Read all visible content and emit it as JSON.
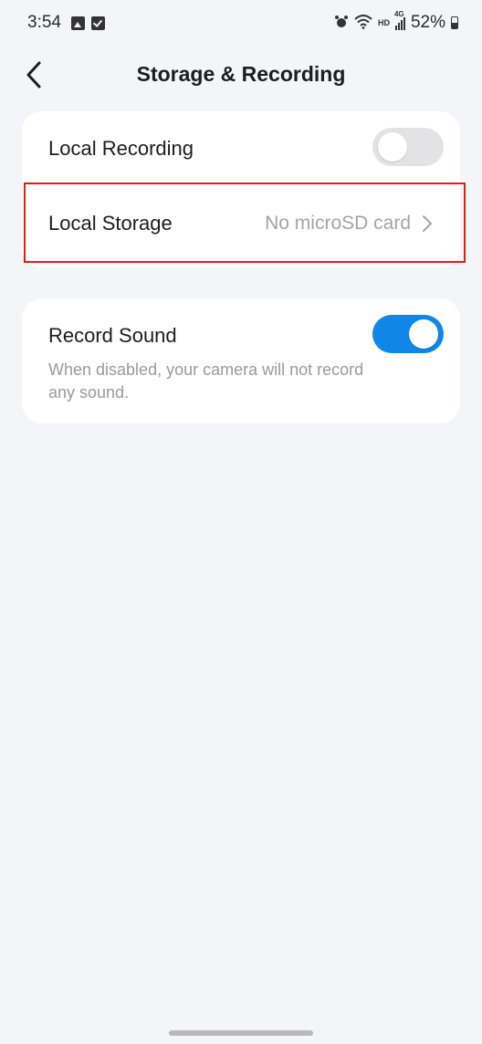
{
  "status_bar": {
    "time": "3:54",
    "battery": "52%",
    "network_label": "HD",
    "network_type": "4G",
    "icons": [
      "gallery-icon",
      "check-icon",
      "alarm-icon",
      "wifi-icon",
      "signal-icon",
      "battery-icon"
    ]
  },
  "header": {
    "title": "Storage & Recording",
    "back_icon": "chevron-left-icon"
  },
  "card1": {
    "local_recording": {
      "label": "Local Recording",
      "toggle_state": "off"
    },
    "local_storage": {
      "label": "Local Storage",
      "value": "No microSD card",
      "highlight_color": "#e21c1c"
    }
  },
  "card2": {
    "record_sound": {
      "label": "Record Sound",
      "description": "When disabled, your camera will not record any sound.",
      "toggle_state": "on"
    }
  },
  "colors": {
    "background": "#f4f5f9",
    "card": "#ffffff",
    "toggle_on": "#1286e6",
    "toggle_off": "#e3e3e6",
    "secondary_text": "#a4a4a8"
  }
}
